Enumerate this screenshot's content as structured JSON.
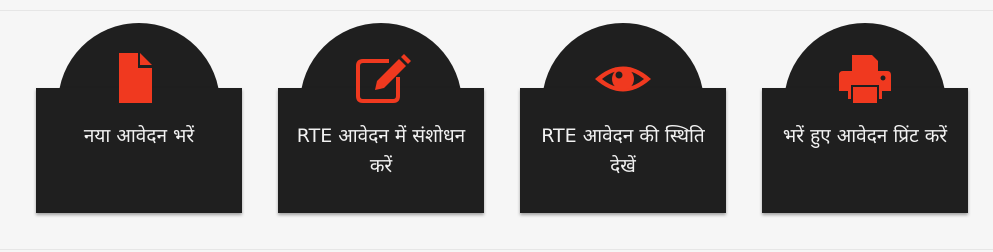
{
  "accent_color": "#f0391f",
  "card_color": "#1f1f1f",
  "cards": [
    {
      "icon": "file-icon",
      "label": "नया आवेदन भरें"
    },
    {
      "icon": "edit-icon",
      "label": "RTE आवेदन में संशोधन करें"
    },
    {
      "icon": "eye-icon",
      "label": "RTE आवेदन की स्थिति देखें"
    },
    {
      "icon": "print-icon",
      "label": "भरें हुए आवेदन प्रिंट करें"
    }
  ]
}
